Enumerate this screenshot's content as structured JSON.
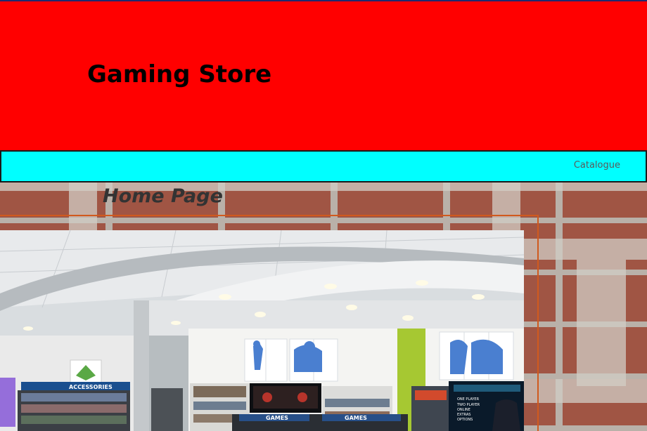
{
  "header": {
    "title": "Gaming Store",
    "background": "#ff0000"
  },
  "nav": {
    "background": "#00ffff",
    "items": [
      {
        "label": "Catalogue"
      }
    ]
  },
  "main": {
    "heading": "Home Page",
    "image": {
      "frame_color": "#d05a1e",
      "signs": {
        "accessories": "ACCESSORIES",
        "games_1": "GAMES",
        "games_2": "GAMES",
        "screen_menu": [
          "ONE PLAYER",
          "TWO PLAYER",
          "ONLINE",
          "EXTRAS",
          "OPTIONS"
        ]
      }
    }
  }
}
